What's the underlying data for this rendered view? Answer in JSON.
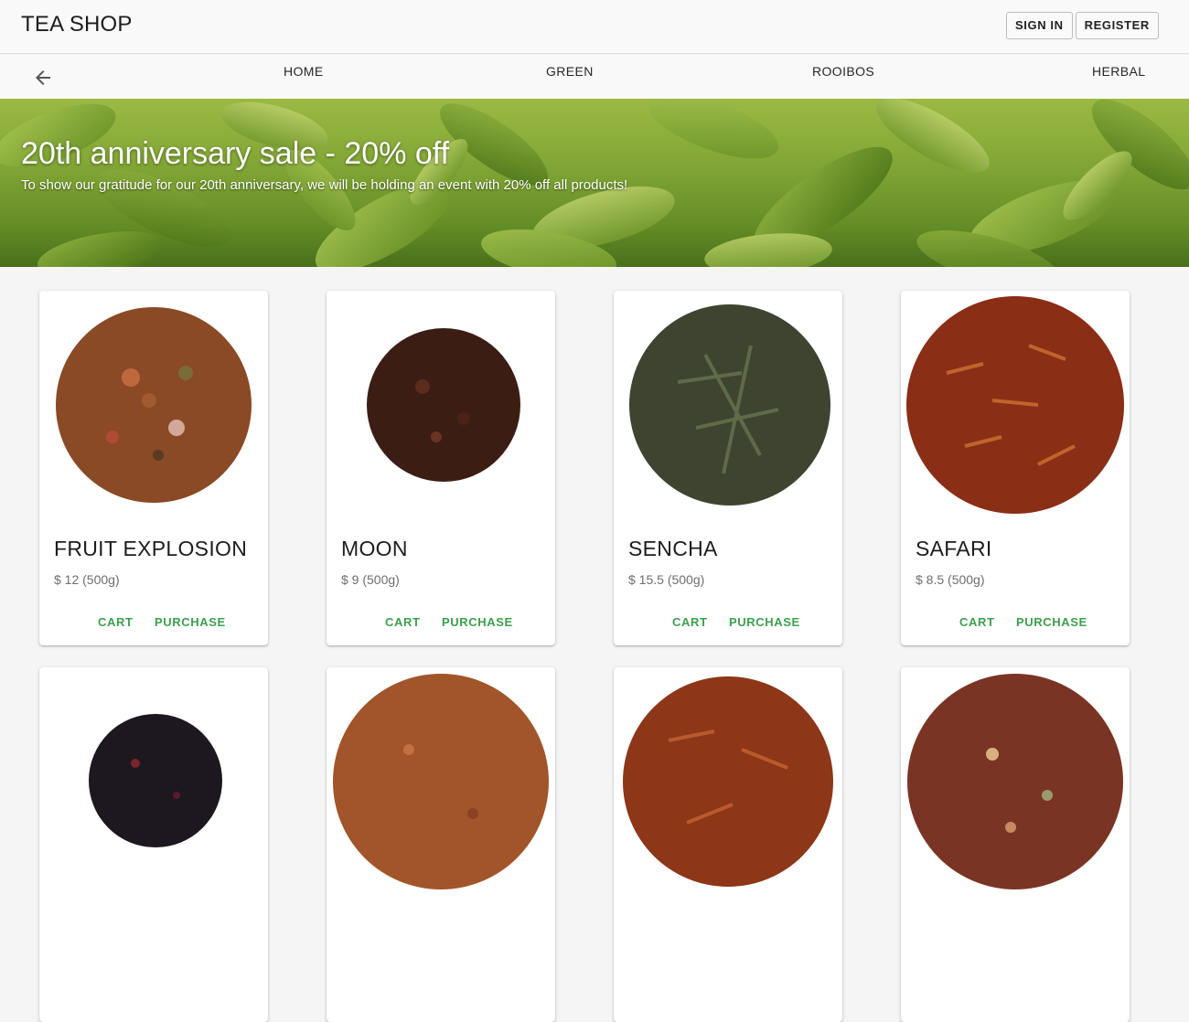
{
  "header": {
    "brand": "TEA SHOP",
    "sign_in_label": "SIGN IN",
    "register_label": "REGISTER"
  },
  "nav": {
    "back_icon": "arrow-back-icon",
    "items": [
      {
        "label": "HOME"
      },
      {
        "label": "GREEN"
      },
      {
        "label": "ROOIBOS"
      },
      {
        "label": "HERBAL"
      }
    ]
  },
  "hero": {
    "title": "20th anniversary sale - 20% off",
    "subtitle": "To show our gratitude for our 20th anniversary, we will be holding an event with 20% off all products!"
  },
  "actions": {
    "cart_label": "CART",
    "purchase_label": "PURCHASE"
  },
  "colors": {
    "accent": "#3d9f4d",
    "appbar_bg": "#f9f9f9",
    "page_bg": "#f5f5f5"
  },
  "products": [
    {
      "name": "FRUIT EXPLOSION",
      "price": "$ 12 (500g)",
      "tea_color": "#8a4a26"
    },
    {
      "name": "MOON",
      "price": "$ 9 (500g)",
      "tea_color": "#3b1d14"
    },
    {
      "name": "SENCHA",
      "price": "$ 15.5 (500g)",
      "tea_color": "#3e4430"
    },
    {
      "name": "SAFARI",
      "price": "$ 8.5 (500g)",
      "tea_color": "#8a2e16"
    },
    {
      "name": "",
      "price": "",
      "tea_color": "#1d1820"
    },
    {
      "name": "",
      "price": "",
      "tea_color": "#a2552a"
    },
    {
      "name": "",
      "price": "",
      "tea_color": "#8e3618"
    },
    {
      "name": "",
      "price": "",
      "tea_color": "#7a3424"
    }
  ]
}
